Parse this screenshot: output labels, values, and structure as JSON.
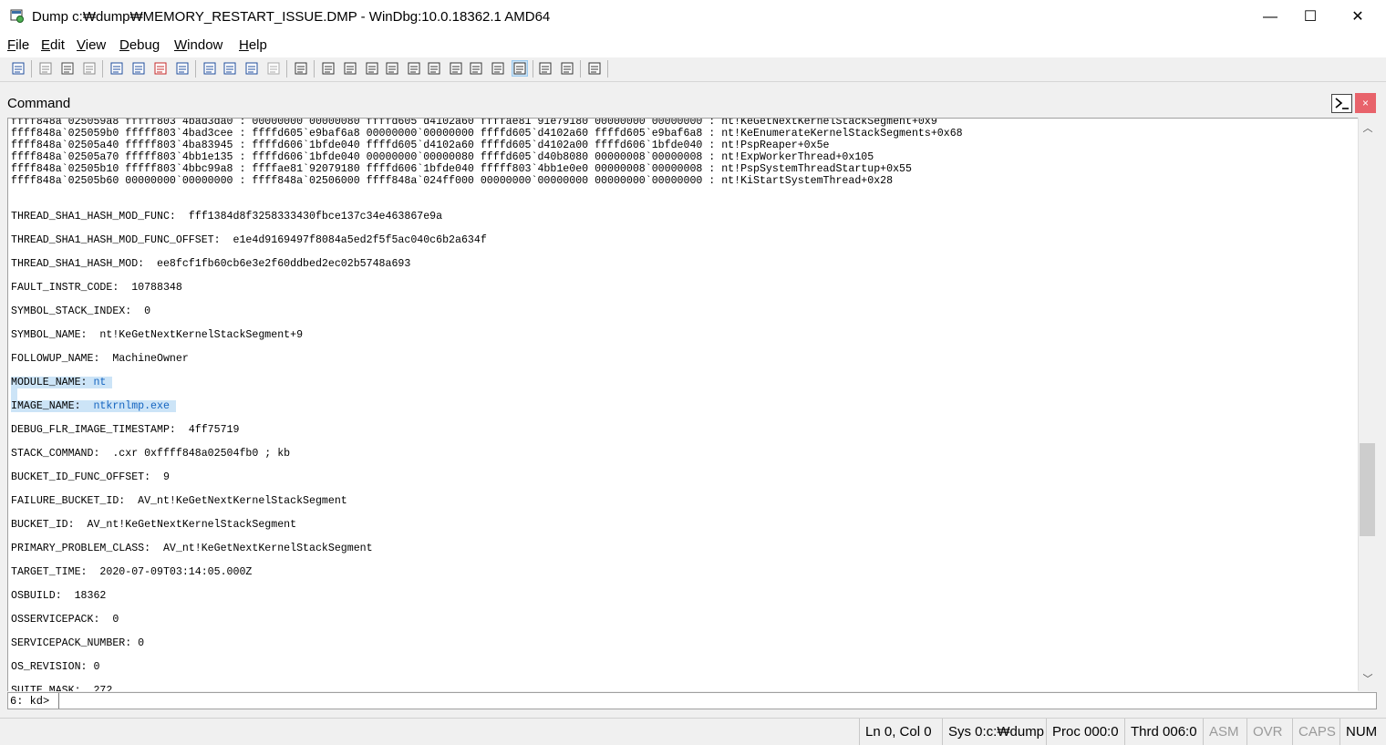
{
  "window": {
    "title": "Dump c:₩dump₩MEMORY_RESTART_ISSUE.DMP - WinDbg:10.0.18362.1 AMD64",
    "minimize_glyph": "—",
    "maximize_glyph": "☐",
    "close_glyph": "✕"
  },
  "menu": [
    {
      "label": "File"
    },
    {
      "label": "Edit"
    },
    {
      "label": "View"
    },
    {
      "label": "Debug"
    },
    {
      "label": "Window"
    },
    {
      "label": "Help"
    }
  ],
  "toolbar_icons": [
    "open-icon",
    "cut-icon",
    "copy-icon",
    "paste-icon",
    "go-icon",
    "restart-icon",
    "stop-debugging-icon",
    "break-icon",
    "step-into-icon",
    "step-over-icon",
    "step-out-icon",
    "run-to-cursor-icon",
    "source-mode-icon",
    "command-window-icon",
    "watch-window-icon",
    "locals-window-icon",
    "registers-window-icon",
    "memory-window-icon",
    "call-stack-icon",
    "disassembly-icon",
    "scratch-pad-icon",
    "processes-threads-icon",
    "source-mode-on-icon",
    "source-mode-off-icon",
    "font-icon",
    "options-icon"
  ],
  "pane": {
    "title": "Command",
    "close_glyph": "×"
  },
  "output_lines": [
    {
      "text": "ffff848a`025059a8 fffff803`4bad3da0 : 00000000`00000080 ffffd605`d4102a60 ffffae81`91e79180 00000000`00000000 : nt!KeGetNextKernelStackSegment+0x9"
    },
    {
      "text": "ffff848a`025059b0 fffff803`4bad3cee : ffffd605`e9baf6a8 00000000`00000000 ffffd605`d4102a60 ffffd605`e9baf6a8 : nt!KeEnumerateKernelStackSegments+0x68"
    },
    {
      "text": "ffff848a`02505a40 fffff803`4ba83945 : ffffd606`1bfde040 ffffd605`d4102a60 ffffd605`d4102a00 ffffd606`1bfde040 : nt!PspReaper+0x5e"
    },
    {
      "text": "ffff848a`02505a70 fffff803`4bb1e135 : ffffd606`1bfde040 00000000`00000080 ffffd605`d40b8080 00000008`00000008 : nt!ExpWorkerThread+0x105"
    },
    {
      "text": "ffff848a`02505b10 fffff803`4bbc99a8 : ffffae81`92079180 ffffd606`1bfde040 fffff803`4bb1e0e0 00000008`00000008 : nt!PspSystemThreadStartup+0x55"
    },
    {
      "text": "ffff848a`02505b60 00000000`00000000 : ffff848a`02506000 ffff848a`024ff000 00000000`00000000 00000000`00000000 : nt!KiStartSystemThread+0x28"
    },
    {
      "text": ""
    },
    {
      "text": ""
    },
    {
      "text": "THREAD_SHA1_HASH_MOD_FUNC:  fff1384d8f3258333430fbce137c34e463867e9a"
    },
    {
      "text": ""
    },
    {
      "text": "THREAD_SHA1_HASH_MOD_FUNC_OFFSET:  e1e4d9169497f8084a5ed2f5f5ac040c6b2a634f"
    },
    {
      "text": ""
    },
    {
      "text": "THREAD_SHA1_HASH_MOD:  ee8fcf1fb60cb6e3e2f60ddbed2ec02b5748a693"
    },
    {
      "text": ""
    },
    {
      "text": "FAULT_INSTR_CODE:  10788348"
    },
    {
      "text": ""
    },
    {
      "text": "SYMBOL_STACK_INDEX:  0"
    },
    {
      "text": ""
    },
    {
      "text": "SYMBOL_NAME:  nt!KeGetNextKernelStackSegment+9"
    },
    {
      "text": ""
    },
    {
      "text": "FOLLOWUP_NAME:  MachineOwner"
    },
    {
      "text": ""
    },
    {
      "text": "MODULE_NAME: nt ",
      "highlight": true
    },
    {
      "text": "",
      "highlight_stub": true
    },
    {
      "text": "IMAGE_NAME:  ntkrnlmp.exe ",
      "highlight": true
    },
    {
      "text": ""
    },
    {
      "text": "DEBUG_FLR_IMAGE_TIMESTAMP:  4ff75719"
    },
    {
      "text": ""
    },
    {
      "text": "STACK_COMMAND:  .cxr 0xffff848a02504fb0 ; kb"
    },
    {
      "text": ""
    },
    {
      "text": "BUCKET_ID_FUNC_OFFSET:  9"
    },
    {
      "text": ""
    },
    {
      "text": "FAILURE_BUCKET_ID:  AV_nt!KeGetNextKernelStackSegment"
    },
    {
      "text": ""
    },
    {
      "text": "BUCKET_ID:  AV_nt!KeGetNextKernelStackSegment"
    },
    {
      "text": ""
    },
    {
      "text": "PRIMARY_PROBLEM_CLASS:  AV_nt!KeGetNextKernelStackSegment"
    },
    {
      "text": ""
    },
    {
      "text": "TARGET_TIME:  2020-07-09T03:14:05.000Z"
    },
    {
      "text": ""
    },
    {
      "text": "OSBUILD:  18362"
    },
    {
      "text": ""
    },
    {
      "text": "OSSERVICEPACK:  0"
    },
    {
      "text": ""
    },
    {
      "text": "SERVICEPACK_NUMBER: 0"
    },
    {
      "text": ""
    },
    {
      "text": "OS_REVISION: 0"
    },
    {
      "text": ""
    },
    {
      "text": "SUITE_MASK:  272"
    }
  ],
  "scrollbar": {
    "up_glyph": "︿",
    "down_glyph": "﹀",
    "position": 0.7
  },
  "command_input": {
    "prompt": "6: kd>",
    "value": ""
  },
  "status": {
    "position": "Ln 0, Col 0",
    "sys": "Sys 0:c:₩dump",
    "proc": "Proc 000:0",
    "thrd": "Thrd 006:0",
    "asm": "ASM",
    "ovr": "OVR",
    "caps": "CAPS",
    "num": "NUM"
  }
}
